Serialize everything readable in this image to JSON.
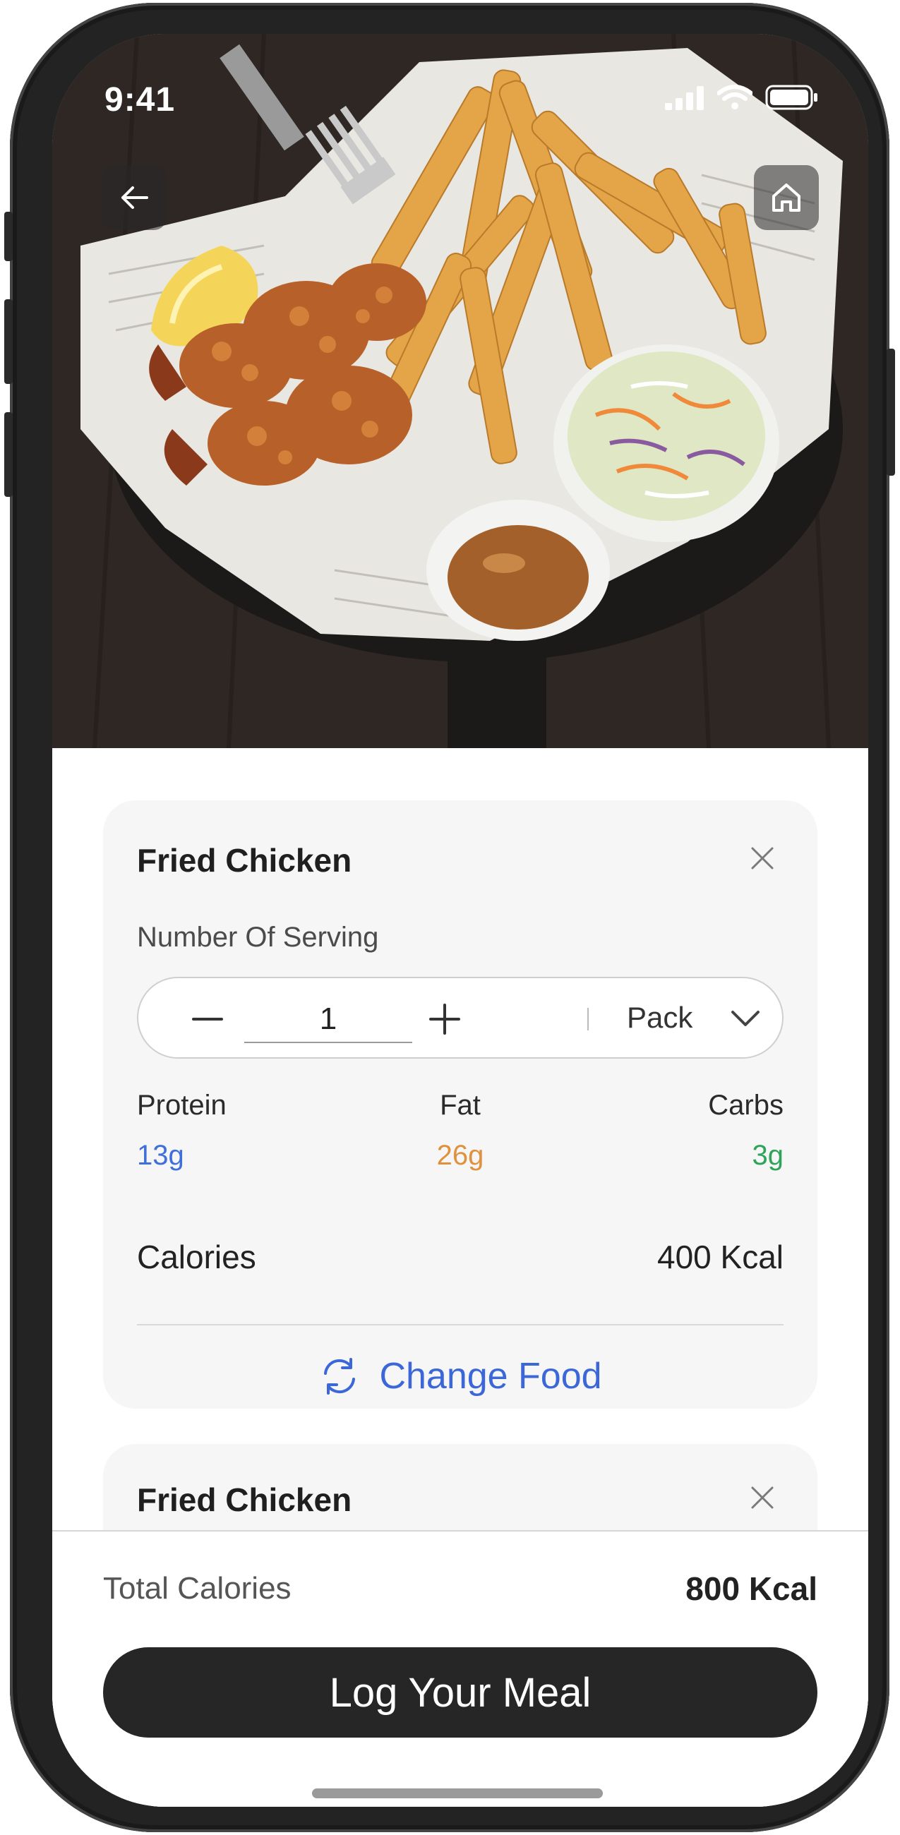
{
  "status_bar": {
    "time": "9:41"
  },
  "hero": {
    "image_alt": "food-photo-chicken-fries-coleslaw",
    "back_icon": "arrow-left-icon",
    "home_icon": "home-icon"
  },
  "meals": [
    {
      "title": "Fried Chicken",
      "serving_label": "Number Of Serving",
      "quantity": "1",
      "unit": "Pack",
      "macros": {
        "protein": {
          "label": "Protein",
          "value": "13g",
          "color": "#3f6fd9"
        },
        "fat": {
          "label": "Fat",
          "value": "26g",
          "color": "#e1913b"
        },
        "carbs": {
          "label": "Carbs",
          "value": "3g",
          "color": "#2ea35a"
        }
      },
      "calories_label": "Calories",
      "calories_value": "400 Kcal",
      "change_food_label": "Change Food"
    },
    {
      "title": "Fried Chicken"
    }
  ],
  "footer": {
    "total_label": "Total Calories",
    "total_value": "800 Kcal",
    "log_button": "Log Your Meal"
  },
  "colors": {
    "accent_blue": "#3c67d8",
    "button_dark": "#262626",
    "card_bg": "#f6f6f6"
  }
}
